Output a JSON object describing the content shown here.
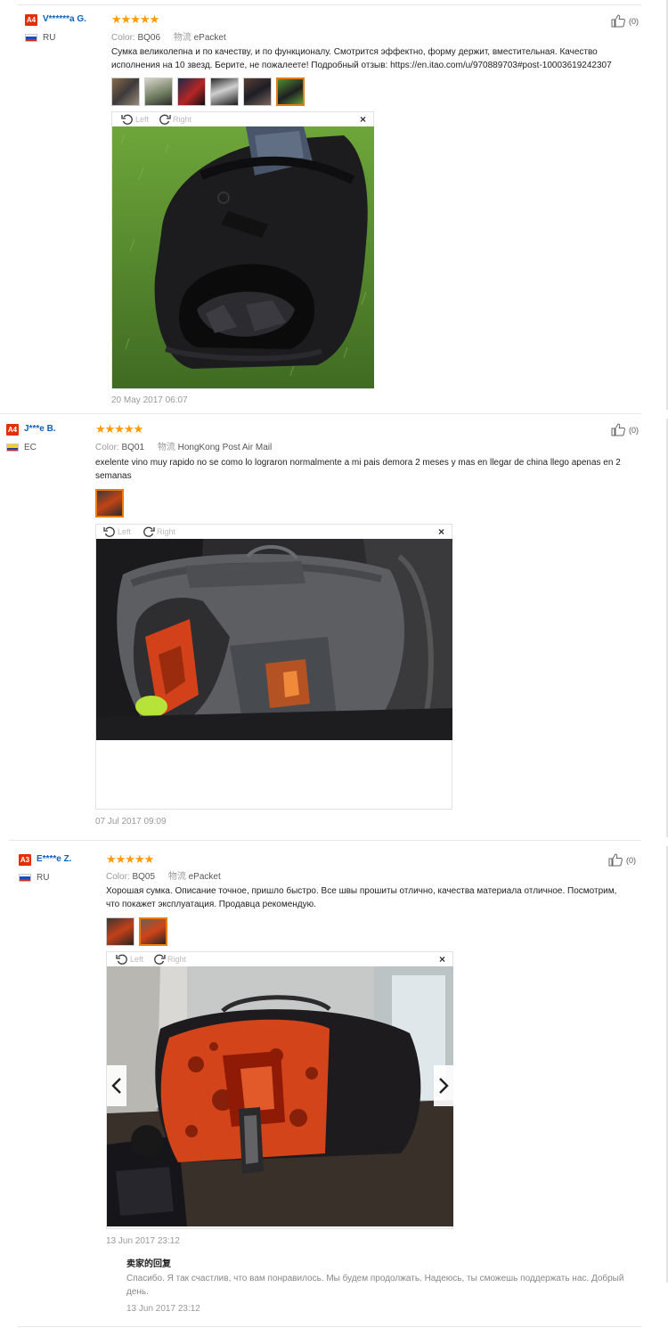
{
  "reviews": [
    {
      "level": "A4",
      "user": "V******a G.",
      "country": "RU",
      "stars": "★★★★★",
      "color_label": "Color:",
      "color_value": "BQ06",
      "shipping_label": "物流",
      "shipping_value": "ePacket",
      "text": "Сумка великолепна и по качеству, и по функционалу. Смотрится эффектно, форму держит, вместительная. Качество исполнения на 10 звезд. Берите, не пожалеете! Подробный отзыв: https://en.itao.com/u/970889703#post-10003619242307",
      "likes": "(0)",
      "rotate_left": "Left",
      "rotate_right": "Right",
      "close": "×",
      "date": "20 May 2017 06:07"
    },
    {
      "level": "A4",
      "user": "J***e B.",
      "country": "EC",
      "stars": "★★★★★",
      "color_label": "Color:",
      "color_value": "BQ01",
      "shipping_label": "物流",
      "shipping_value": "HongKong Post Air Mail",
      "text": "exelente vino muy rapido no se como lo lograron normalmente a mi pais demora 2 meses y mas en llegar de china llego apenas en 2 semanas",
      "likes": "(0)",
      "rotate_left": "Left",
      "rotate_right": "Right",
      "close": "×",
      "date": "07 Jul 2017 09:09"
    },
    {
      "level": "A3",
      "user": "E****e Z.",
      "country": "RU",
      "stars": "★★★★★",
      "color_label": "Color:",
      "color_value": "BQ05",
      "shipping_label": "物流",
      "shipping_value": "ePacket",
      "text": "Хорошая сумка. Описание точное, пришло быстро. Все швы прошиты отлично, качества материала отличное. Посмотрим, что покажет эксплуатация. Продавца рекомендую.",
      "likes": "(0)",
      "rotate_left": "Left",
      "rotate_right": "Right",
      "close": "×",
      "date": "13 Jun 2017 23:12",
      "reply": {
        "title": "卖家的回复",
        "text": "Спасибо. Я так счастлив, что вам понравилось. Мы будем продолжать. Надеюсь, ты сможешь поддержать нас. Добрый день.",
        "date": "13 Jun 2017 23:12"
      }
    }
  ],
  "colors": {
    "level_badge": "#e62e04",
    "username": "#1060b8",
    "stars": "#ff9a00",
    "active_thumb_border": "#e87e13"
  },
  "icons": [
    "thumbs-up-icon",
    "rotate-left-icon",
    "rotate-right-icon",
    "close-icon",
    "chevron-left-icon",
    "chevron-right-icon",
    "flag-icon"
  ]
}
